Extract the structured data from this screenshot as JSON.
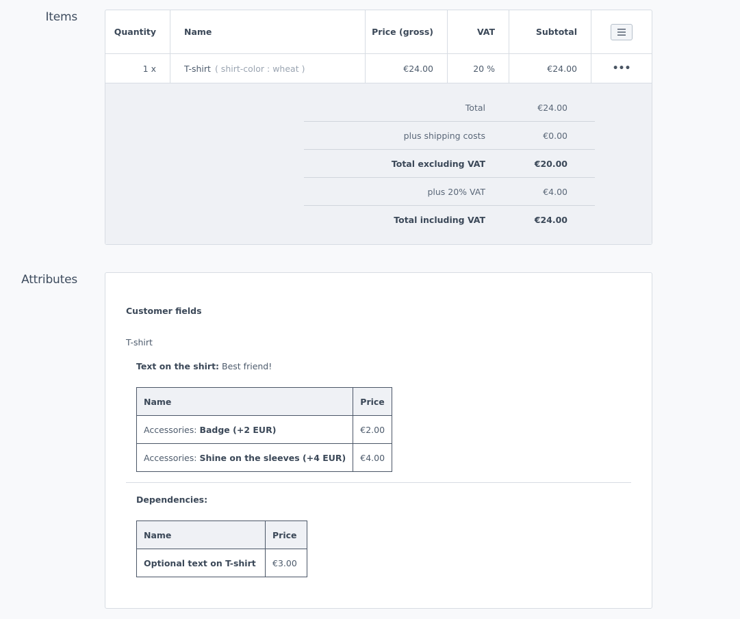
{
  "sections": {
    "items_label": "Items",
    "attributes_label": "Attributes"
  },
  "items_table": {
    "headers": {
      "quantity": "Quantity",
      "name": "Name",
      "price": "Price (gross)",
      "vat": "VAT",
      "subtotal": "Subtotal"
    },
    "rows": [
      {
        "quantity": "1 x",
        "name": "T-shirt",
        "attribute": "( shirt-color : wheat )",
        "price": "€24.00",
        "vat": "20 %",
        "subtotal": "€24.00",
        "action": "•••"
      }
    ]
  },
  "totals": [
    {
      "label": "Total",
      "value": "€24.00"
    },
    {
      "label": "plus shipping costs",
      "value": "€0.00"
    },
    {
      "label": "Total excluding VAT",
      "value": "€20.00"
    },
    {
      "label": "plus 20% VAT",
      "value": "€4.00"
    },
    {
      "label": "Total including VAT",
      "value": "€24.00"
    }
  ],
  "attributes": {
    "customer_fields_title": "Customer fields",
    "product_name": "T-shirt",
    "text_label": "Text on the shirt:",
    "text_value": "Best friend!",
    "accessories_table": {
      "header_name": "Name",
      "header_price": "Price",
      "rows": [
        {
          "prefix": "Accessories:",
          "name": "Badge (+2 EUR)",
          "price": "€2.00"
        },
        {
          "prefix": "Accessories:",
          "name": "Shine on the sleeves (+4 EUR)",
          "price": "€4.00"
        }
      ]
    },
    "dependencies_title": "Dependencies:",
    "dependencies_table": {
      "header_name": "Name",
      "header_price": "Price",
      "rows": [
        {
          "name": "Optional text on T-shirt",
          "price": "€3.00"
        }
      ]
    }
  },
  "icons": {
    "menu": "hamburger-menu-icon",
    "more": "more-dots-icon"
  }
}
